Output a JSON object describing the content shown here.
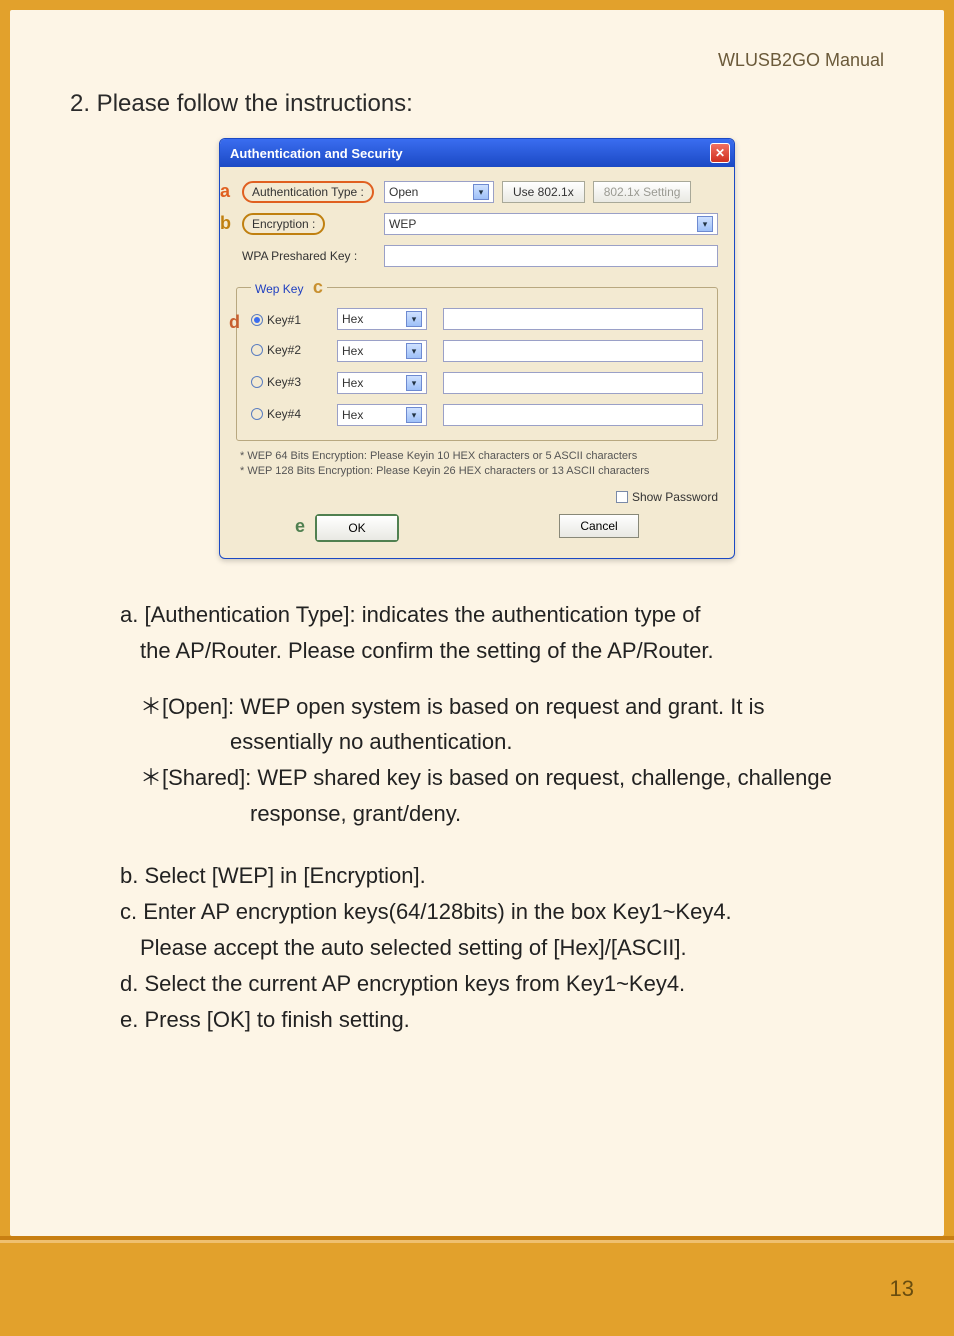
{
  "header": {
    "manual_label": "WLUSB2GO  Manual"
  },
  "section": {
    "title": "2. Please follow the instructions:"
  },
  "dialog": {
    "title": "Authentication and Security",
    "auth_type_label": "Authentication Type :",
    "auth_type_value": "Open",
    "use_8021x_label": "Use 802.1x",
    "setting_8021x_label": "802.1x Setting",
    "encryption_label": "Encryption :",
    "encryption_value": "WEP",
    "wpa_label": "WPA Preshared Key :",
    "wep_legend": "Wep Key",
    "keys": [
      {
        "label": "Key#1",
        "format": "Hex",
        "value": "",
        "selected": true
      },
      {
        "label": "Key#2",
        "format": "Hex",
        "value": "",
        "selected": false
      },
      {
        "label": "Key#3",
        "format": "Hex",
        "value": "",
        "selected": false
      },
      {
        "label": "Key#4",
        "format": "Hex",
        "value": "",
        "selected": false
      }
    ],
    "hint1": "* WEP 64 Bits Encryption:  Please Keyin 10 HEX characters or 5 ASCII characters",
    "hint2": "* WEP 128 Bits Encryption:  Please Keyin 26 HEX characters or 13 ASCII characters",
    "show_password_label": "Show Password",
    "ok_label": "OK",
    "cancel_label": "Cancel"
  },
  "markers": {
    "a": "a",
    "b": "b",
    "c": "c",
    "d": "d",
    "e": "e"
  },
  "explain": {
    "a_line1": "a. [Authentication Type]: indicates the authentication type of",
    "a_line2": "the AP/Router. Please confirm the setting of the AP/Router.",
    "open_line1": "[Open]: WEP open system is based on request and grant. It is",
    "open_line2": "essentially no authentication.",
    "shared_line1": "[Shared]: WEP shared key is based on request, challenge, challenge",
    "shared_line2": "response, grant/deny.",
    "b": "b. Select  [WEP] in [Encryption].",
    "c_line1": "c. Enter AP encryption keys(64/128bits) in the box Key1~Key4.",
    "c_line2": "Please accept the auto selected setting of [Hex]/[ASCII].",
    "d": "d. Select the current AP encryption keys from Key1~Key4.",
    "e": "e. Press [OK] to finish setting.",
    "star": "＊"
  },
  "page_number": "13"
}
